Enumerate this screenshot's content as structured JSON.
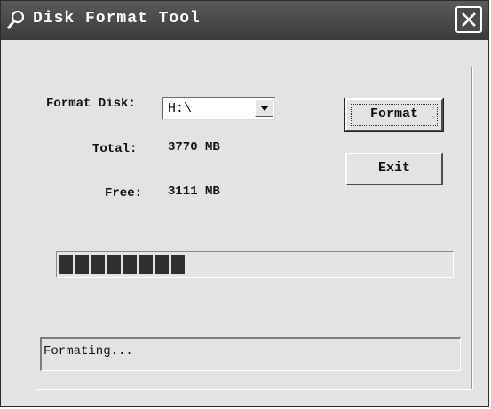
{
  "window": {
    "title": "Disk Format Tool"
  },
  "form": {
    "disk_label": "Format Disk:",
    "disk_value": "H:\\",
    "total_label": "Total:",
    "total_value": "3770 MB",
    "free_label": "Free:",
    "free_value": "3111 MB"
  },
  "buttons": {
    "format": "Format",
    "exit": "Exit"
  },
  "progress": {
    "filled_segments": 8,
    "fraction": 0.33
  },
  "status": {
    "text": "Formating..."
  },
  "icons": {
    "title": "magnifier-icon",
    "close": "close-icon",
    "dropdown": "chevron-down-icon"
  },
  "colors": {
    "titlebar": "#3f3f3f",
    "window": "#e3e3e3",
    "progress_fill": "#2f2f2f"
  }
}
